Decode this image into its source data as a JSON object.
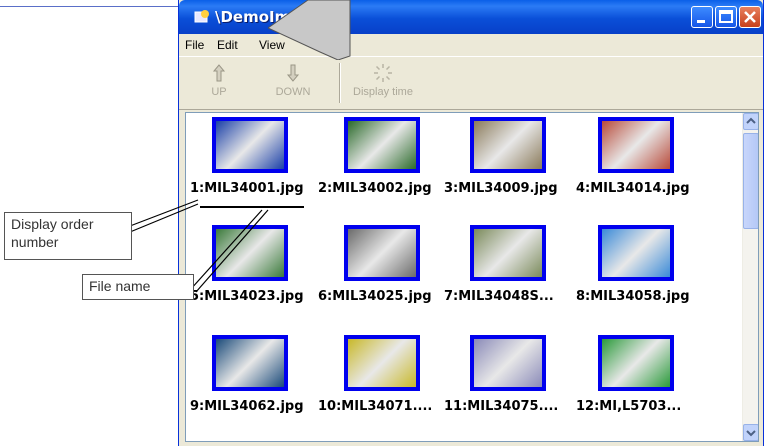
{
  "window": {
    "title": "\\DemoImage",
    "title_visible": "\\DemoImag"
  },
  "menu": [
    "File",
    "Edit",
    "View"
  ],
  "toolbar": {
    "buttons": [
      {
        "label": "UP",
        "icon": "up-hand-icon"
      },
      {
        "label": "DOWN",
        "icon": "down-hand-icon"
      },
      {
        "label": "Display time",
        "icon": "display-time-icon"
      }
    ]
  },
  "files": [
    {
      "label": "1:MIL34001.jpg",
      "color": "#1a3fa8"
    },
    {
      "label": "2:MIL34002.jpg",
      "color": "#2a6a2a"
    },
    {
      "label": "3:MIL34009.jpg",
      "color": "#8a7a5a"
    },
    {
      "label": "4:MIL34014.jpg",
      "color": "#b84a3a"
    },
    {
      "label": "5:MIL34023.jpg",
      "color": "#3a7a3a"
    },
    {
      "label": "6:MIL34025.jpg",
      "color": "#6a6a6a"
    },
    {
      "label": "7:MIL34048S...",
      "color": "#7a8a5a"
    },
    {
      "label": "8:MIL34058.jpg",
      "color": "#3a8ad8"
    },
    {
      "label": "9:MIL34062.jpg",
      "color": "#1a4a7a"
    },
    {
      "label": "10:MIL34071....",
      "color": "#c8b828"
    },
    {
      "label": "11:MIL34075....",
      "color": "#8a8ab8"
    },
    {
      "label": "12:MI,L5703...",
      "color": "#2a9a3a"
    }
  ],
  "callouts": {
    "display_order": "Display order number",
    "display_order_line1": "Display order",
    "display_order_line2": "number",
    "file_name": "File name"
  }
}
